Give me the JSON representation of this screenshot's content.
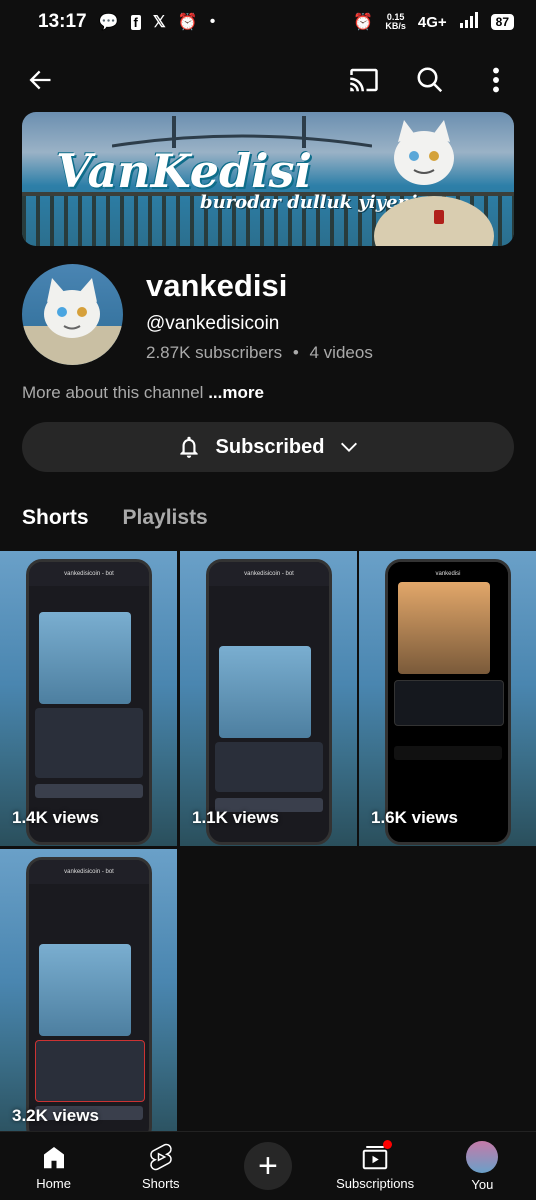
{
  "status_bar": {
    "time": "13:17",
    "net_speed_value": "0.15",
    "net_speed_unit": "KB/s",
    "network": "4G+",
    "battery": "87"
  },
  "banner": {
    "title": "VanKedisi",
    "subtitle": "burodar dulluk yiyenim"
  },
  "channel": {
    "name": "vankedisi",
    "handle": "@vankedisicoin",
    "subscribers": "2.87K subscribers",
    "separator": "•",
    "videos": "4 videos",
    "more_prefix": "More about this channel",
    "more_link": "...more"
  },
  "subscribe_button": {
    "label": "Subscribed"
  },
  "tabs": [
    {
      "label": "Shorts",
      "active": true
    },
    {
      "label": "Playlists",
      "active": false
    }
  ],
  "shorts": [
    {
      "views": "1.4K views",
      "phone_title": "vankedisicoin - bot"
    },
    {
      "views": "1.1K views",
      "phone_title": "vankedisicoin - bot"
    },
    {
      "views": "1.6K views",
      "phone_title": "vankedisi"
    },
    {
      "views": "3.2K views",
      "phone_title": "vankedisicoin - bot"
    }
  ],
  "bottom_nav": [
    {
      "label": "Home",
      "icon": "home-icon"
    },
    {
      "label": "Shorts",
      "icon": "shorts-icon"
    },
    {
      "label": "",
      "icon": "create-icon"
    },
    {
      "label": "Subscriptions",
      "icon": "subscriptions-icon"
    },
    {
      "label": "You",
      "icon": "you-avatar"
    }
  ],
  "colors": {
    "background": "#0f0f0f",
    "button": "#272727",
    "secondary_text": "#aaaaaa",
    "badge": "#ff0000"
  }
}
